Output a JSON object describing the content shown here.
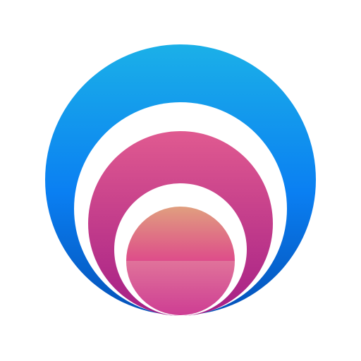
{
  "logo": {
    "icon": "concentric-circles-logo-icon",
    "colors": {
      "background": "#ffffff",
      "outer_top": "#1bb0e8",
      "outer_mid": "#0a7ff2",
      "outer_bottom": "#0451b8",
      "ring_gap": "#ffffff",
      "middle_top": "#e05a90",
      "middle_bottom": "#a51f86",
      "inner_top": "#e0a27e",
      "inner_mid": "#de4c8a",
      "inner_bottom_top": "#e0739a",
      "inner_bottom": "#cd3b93"
    }
  }
}
